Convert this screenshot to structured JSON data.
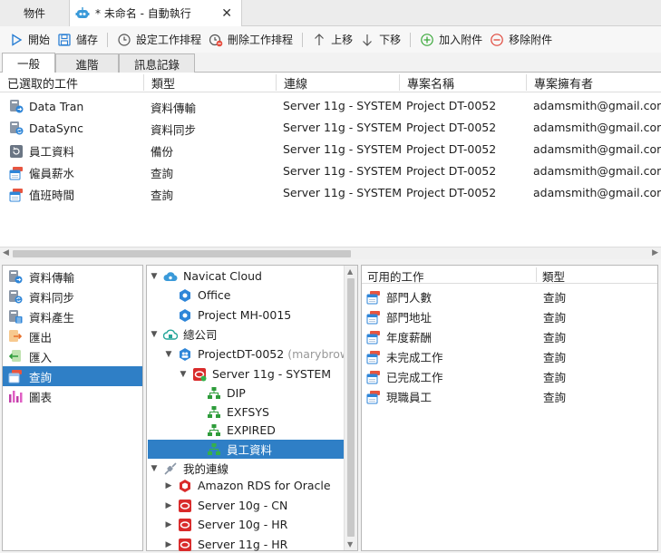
{
  "doc_tabs": [
    {
      "label": "物件"
    },
    {
      "label": "* 未命名 - 自動執行",
      "close": "✕"
    }
  ],
  "toolbar": {
    "start": "開始",
    "save": "儲存",
    "set_schedule": "設定工作排程",
    "delete_schedule": "刪除工作排程",
    "move_up": "上移",
    "move_down": "下移",
    "add_attachment": "加入附件",
    "remove_attachment": "移除附件"
  },
  "sub_tabs": [
    "一般",
    "進階",
    "訊息記錄"
  ],
  "jobs_table": {
    "columns": [
      "已選取的工件",
      "類型",
      "連線",
      "專案名稱",
      "專案擁有者"
    ],
    "rows": [
      {
        "name": "Data Tran",
        "type": "資料傳輸",
        "connection": "Server 11g - SYSTEM",
        "project": "Project DT-0052",
        "owner": "adamsmith@gmail.com",
        "icon": "data-transfer-icon"
      },
      {
        "name": "DataSync",
        "type": "資料同步",
        "connection": "Server 11g - SYSTEM",
        "project": "Project DT-0052",
        "owner": "adamsmith@gmail.com",
        "icon": "data-sync-icon"
      },
      {
        "name": "員工資料",
        "type": "備份",
        "connection": "Server 11g - SYSTEM",
        "project": "Project DT-0052",
        "owner": "adamsmith@gmail.com",
        "icon": "backup-icon"
      },
      {
        "name": "僱員薪水",
        "type": "查詢",
        "connection": "Server 11g - SYSTEM",
        "project": "Project DT-0052",
        "owner": "adamsmith@gmail.com",
        "icon": "query-icon"
      },
      {
        "name": "值班時間",
        "type": "查詢",
        "connection": "Server 11g - SYSTEM",
        "project": "Project DT-0052",
        "owner": "adamsmith@gmail.com",
        "icon": "query-icon"
      }
    ]
  },
  "categories": [
    {
      "label": "資料傳輸",
      "icon": "data-transfer-icon"
    },
    {
      "label": "資料同步",
      "icon": "data-sync-icon"
    },
    {
      "label": "資料產生",
      "icon": "data-generation-icon"
    },
    {
      "label": "匯出",
      "icon": "export-icon"
    },
    {
      "label": "匯入",
      "icon": "import-icon"
    },
    {
      "label": "查詢",
      "icon": "query-icon",
      "selected": true
    },
    {
      "label": "圖表",
      "icon": "chart-icon"
    }
  ],
  "tree": [
    {
      "label": "Navicat Cloud",
      "icon": "cloud-icon",
      "twisty": "▼"
    },
    {
      "label": "Office",
      "icon": "project-icon"
    },
    {
      "label": "Project MH-0015",
      "icon": "project-icon"
    },
    {
      "label": "總公司",
      "icon": "on-prem-cloud-icon",
      "twisty": "▼"
    },
    {
      "label": "ProjectDT-0052",
      "icon": "shared-project-icon",
      "twisty": "▼",
      "muted": "(marybrown"
    },
    {
      "label": "Server 11g - SYSTEM",
      "icon": "oracle-connection-icon",
      "twisty": "▼"
    },
    {
      "label": "DIP",
      "icon": "schema-icon"
    },
    {
      "label": "EXFSYS",
      "icon": "schema-icon"
    },
    {
      "label": "EXPIRED",
      "icon": "schema-icon"
    },
    {
      "label": "員工資料",
      "icon": "schema-icon",
      "selected": true
    },
    {
      "label": "我的連線",
      "icon": "connections-icon",
      "twisty": "▼"
    },
    {
      "label": "Amazon RDS for Oracle",
      "icon": "amazon-rds-icon",
      "twisty": "▶"
    },
    {
      "label": "Server 10g - CN",
      "icon": "oracle-icon",
      "twisty": "▶"
    },
    {
      "label": "Server 10g - HR",
      "icon": "oracle-icon",
      "twisty": "▶"
    },
    {
      "label": "Server 11g - HR",
      "icon": "oracle-icon",
      "twisty": "▶"
    }
  ],
  "available": {
    "columns": [
      "可用的工作",
      "類型"
    ],
    "rows": [
      {
        "name": "部門人數",
        "type": "查詢"
      },
      {
        "name": "部門地址",
        "type": "查詢"
      },
      {
        "name": "年度薪酬",
        "type": "查詢"
      },
      {
        "name": "未完成工作",
        "type": "查詢"
      },
      {
        "name": "已完成工作",
        "type": "查詢"
      },
      {
        "name": "現職員工",
        "type": "查詢"
      }
    ]
  }
}
